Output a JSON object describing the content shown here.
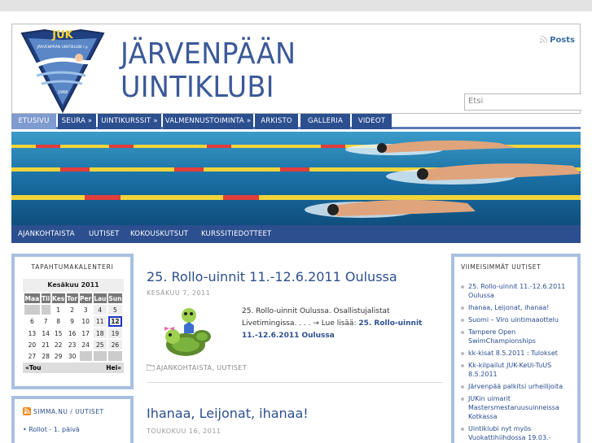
{
  "site": {
    "title_line1": "JÄRVENPÄÄN",
    "title_line2": "UINTIKLUBI",
    "posts_link": "Posts",
    "search_placeholder": "Etsi",
    "logo_text": "JUK",
    "logo_subtext": "JÄRVENPÄÄN UINTIKLUBI r.y.",
    "logo_year": "1968"
  },
  "main_nav": [
    {
      "label": "ETUSIVU",
      "active": true
    },
    {
      "label": "SEURA »",
      "active": false
    },
    {
      "label": "UINTIKURSSIT »",
      "active": false
    },
    {
      "label": "VALMENNUSTOIMINTA »",
      "active": false
    },
    {
      "label": "ARKISTO",
      "active": false
    },
    {
      "label": "GALLERIA",
      "active": false
    },
    {
      "label": "VIDEOT",
      "active": false
    }
  ],
  "sub_nav": [
    "AJANKOHTAISTA",
    "UUTISET",
    "KOKOUSKUTSUT",
    "KURSSITIEDOTTEET"
  ],
  "calendar": {
    "widget_title": "TAPAHTUMAKALENTERI",
    "month": "Kesäkuu 2011",
    "days": [
      "Maa",
      "Tii",
      "Kes",
      "Tor",
      "Per",
      "Lau",
      "Sun"
    ],
    "weeks": [
      [
        "",
        "",
        "1",
        "2",
        "3",
        "4",
        "5"
      ],
      [
        "6",
        "7",
        "8",
        "9",
        "10",
        "11",
        "12"
      ],
      [
        "13",
        "14",
        "15",
        "16",
        "17",
        "18",
        "19"
      ],
      [
        "20",
        "21",
        "22",
        "23",
        "24",
        "25",
        "26"
      ],
      [
        "27",
        "28",
        "29",
        "30",
        "",
        "",
        ""
      ]
    ],
    "today": "12",
    "prev": "«Tou",
    "next": "Hei»"
  },
  "rss_widget": {
    "title": "SIMMA.NU / UUTISET",
    "items": [
      "Rollot - 1. päivä"
    ]
  },
  "posts": [
    {
      "title": "25. Rollo-uinnit 11.-12.6.2011 Oulussa",
      "date": "KESÄKUU 7, 2011",
      "excerpt": "25. Rollo-uinnit Oulussa. Osallistujalistat Livetimingissa. . . . → Lue lisää:",
      "read_more": "25. Rollo-uinnit 11.-12.6.2011 Oulussa",
      "categories": "AJANKOHTAISTA, UUTISET"
    },
    {
      "title": "Ihanaa, Leijonat, ihanaa!",
      "date": "TOUKOKUU 16, 2011"
    }
  ],
  "recent_news": {
    "title": "VIIMEISIMMÄT UUTISET",
    "items": [
      "25. Rollo-uinnit 11.-12.6.2011 Oulussa",
      "Ihanaa, Leijonat, ihanaa!",
      "Suomi – Viro uintimaaottelu",
      "Tampere Open SwimChampionships",
      "kk-kisat 8.5.2011 : Tulokset",
      "Kk-kilpailut JUK-KeUi-TuUS 8.5.2011",
      "Järvenpää palkitsi urheilijoita",
      "JUKin uimarit Mastersmestaruusuinneissa Kotkassa",
      "Uintiklubi nyt myös Vuokattihiihdossa 19.03.-"
    ]
  },
  "colors": {
    "nav_bg": "#2c4f8f",
    "nav_active": "#7f9bcf",
    "title_blue": "#3b5998",
    "box_border": "#a8c0df"
  }
}
